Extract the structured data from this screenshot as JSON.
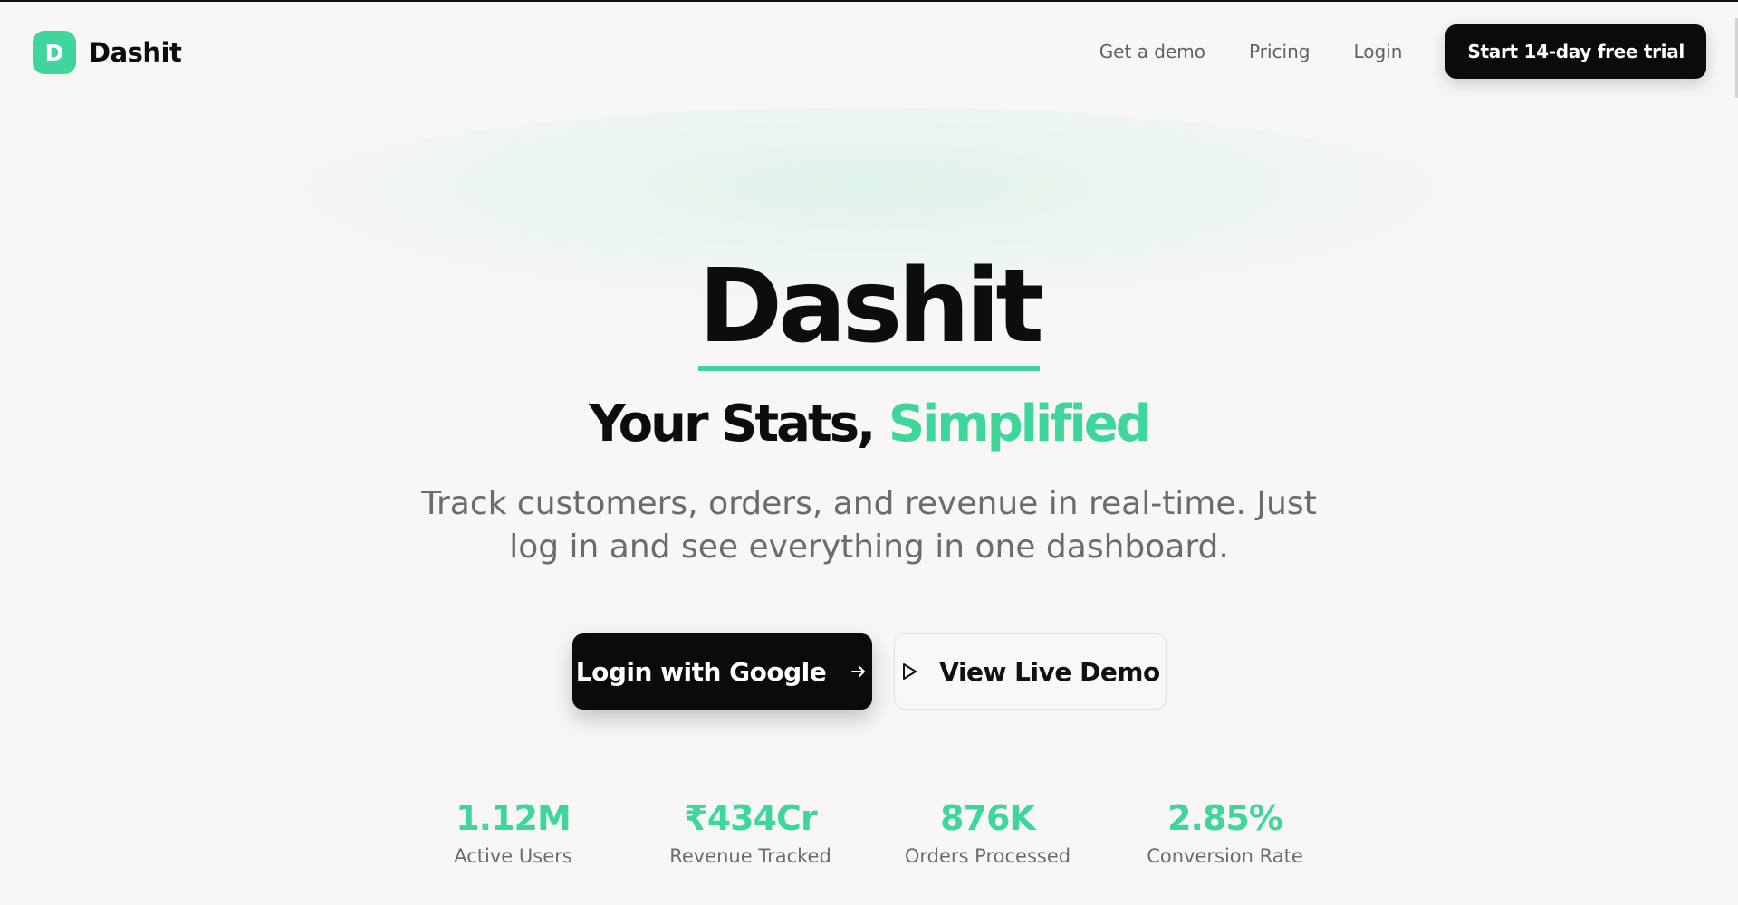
{
  "brand": {
    "logo_letter": "D",
    "name": "Dashit",
    "accent": "#3fd69c"
  },
  "nav": {
    "links": [
      "Get a demo",
      "Pricing",
      "Login"
    ],
    "cta": "Start 14-day free trial"
  },
  "hero": {
    "title": "Dashit",
    "tagline_plain": "Your Stats, ",
    "tagline_accent": "Simplified",
    "subtitle": "Track customers, orders, and revenue in real-time. Just log in and see everything in one dashboard.",
    "primary_cta": "Login with Google",
    "secondary_cta": "View Live Demo"
  },
  "stats": [
    {
      "value": "1.12M",
      "label": "Active Users"
    },
    {
      "value": "₹434Cr",
      "label": "Revenue Tracked"
    },
    {
      "value": "876K",
      "label": "Orders Processed"
    },
    {
      "value": "2.85%",
      "label": "Conversion Rate"
    }
  ],
  "icons": {
    "primary_cta_icon": "arrow-right-icon",
    "secondary_cta_icon": "play-icon"
  }
}
